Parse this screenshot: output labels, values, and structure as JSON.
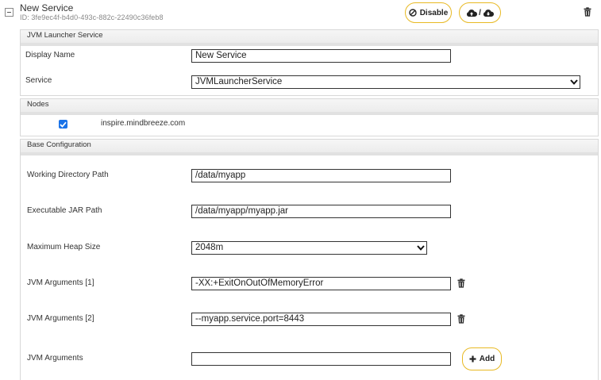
{
  "service": {
    "title": "New Service",
    "id_text": "ID: 3fe9ec4f-b4d0-493c-882c-22490c36feb8",
    "disable_label": "Disable",
    "cloud_separator": "/"
  },
  "launcher": {
    "header": "JVM Launcher Service",
    "display_name_label": "Display Name",
    "display_name_value": "New Service",
    "service_label": "Service",
    "service_value": "JVMLauncherService"
  },
  "nodes": {
    "header": "Nodes",
    "items": [
      {
        "label": "inspire.mindbreeze.com",
        "checked": true
      }
    ]
  },
  "base": {
    "header": "Base Configuration",
    "working_dir_label": "Working Directory Path",
    "working_dir_value": "/data/myapp",
    "jar_label": "Executable JAR Path",
    "jar_value": "/data/myapp/myapp.jar",
    "heap_label": "Maximum Heap Size",
    "heap_value": "2048m",
    "jvm_args": [
      {
        "label": "JVM Arguments [1]",
        "value": "-XX:+ExitOnOutOfMemoryError"
      },
      {
        "label": "JVM Arguments [2]",
        "value": "--myapp.service.port=8443"
      }
    ],
    "jvm_new_label": "JVM Arguments",
    "jvm_new_value": "",
    "add_label": "Add"
  },
  "colors": {
    "accent_border": "#e8b923",
    "checkbox": "#1a73e8"
  }
}
